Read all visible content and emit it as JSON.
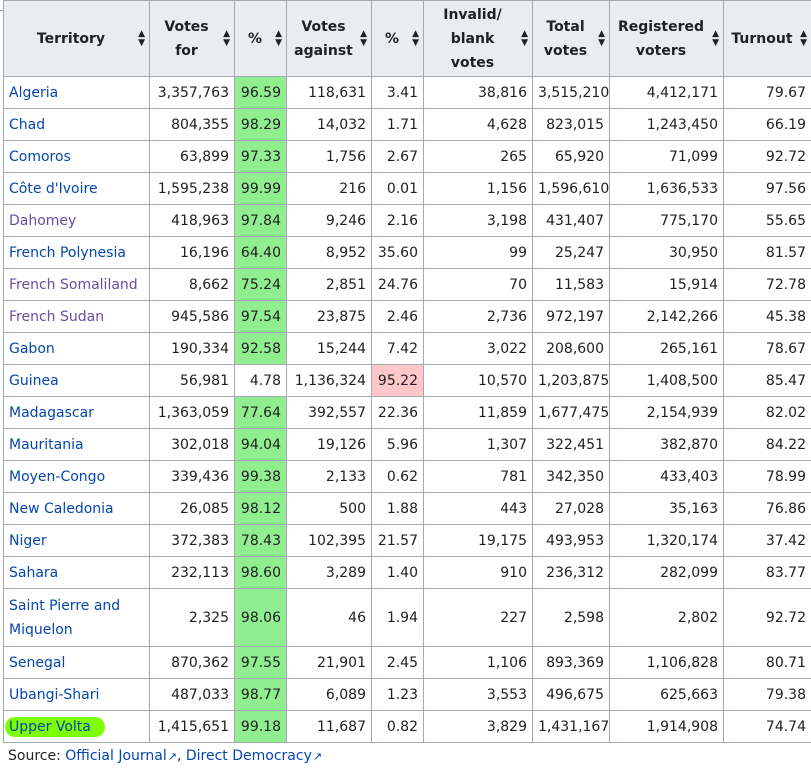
{
  "columns": [
    {
      "id": "territory",
      "label": "Territory"
    },
    {
      "id": "votes_for",
      "label": "Votes for"
    },
    {
      "id": "pct_for",
      "label": "%"
    },
    {
      "id": "votes_against",
      "label": "Votes against"
    },
    {
      "id": "pct_against",
      "label": "%"
    },
    {
      "id": "invalid",
      "label": "Invalid/ blank votes"
    },
    {
      "id": "total",
      "label": "Total votes"
    },
    {
      "id": "registered",
      "label": "Registered voters"
    },
    {
      "id": "turnout",
      "label": "Turnout"
    }
  ],
  "sort_icon": "sort-arrows-icon",
  "rows": [
    {
      "territory": "Algeria",
      "votes_for": "3,357,763",
      "pct_for": "96.59",
      "votes_against": "118,631",
      "pct_against": "3.41",
      "invalid": "38,816",
      "total": "3,515,210",
      "registered": "4,412,171",
      "turnout": "79.67"
    },
    {
      "territory": "Chad",
      "votes_for": "804,355",
      "pct_for": "98.29",
      "votes_against": "14,032",
      "pct_against": "1.71",
      "invalid": "4,628",
      "total": "823,015",
      "registered": "1,243,450",
      "turnout": "66.19"
    },
    {
      "territory": "Comoros",
      "votes_for": "63,899",
      "pct_for": "97.33",
      "votes_against": "1,756",
      "pct_against": "2.67",
      "invalid": "265",
      "total": "65,920",
      "registered": "71,099",
      "turnout": "92.72"
    },
    {
      "territory": "Côte d'Ivoire",
      "votes_for": "1,595,238",
      "pct_for": "99.99",
      "votes_against": "216",
      "pct_against": "0.01",
      "invalid": "1,156",
      "total": "1,596,610",
      "registered": "1,636,533",
      "turnout": "97.56"
    },
    {
      "territory": "Dahomey",
      "votes_for": "418,963",
      "pct_for": "97.84",
      "votes_against": "9,246",
      "pct_against": "2.16",
      "invalid": "3,198",
      "total": "431,407",
      "registered": "775,170",
      "turnout": "55.65"
    },
    {
      "territory": "French Polynesia",
      "votes_for": "16,196",
      "pct_for": "64.40",
      "votes_against": "8,952",
      "pct_against": "35.60",
      "invalid": "99",
      "total": "25,247",
      "registered": "30,950",
      "turnout": "81.57"
    },
    {
      "territory": "French Somaliland",
      "votes_for": "8,662",
      "pct_for": "75.24",
      "votes_against": "2,851",
      "pct_against": "24.76",
      "invalid": "70",
      "total": "11,583",
      "registered": "15,914",
      "turnout": "72.78"
    },
    {
      "territory": "French Sudan",
      "votes_for": "945,586",
      "pct_for": "97.54",
      "votes_against": "23,875",
      "pct_against": "2.46",
      "invalid": "2,736",
      "total": "972,197",
      "registered": "2,142,266",
      "turnout": "45.38"
    },
    {
      "territory": "Gabon",
      "votes_for": "190,334",
      "pct_for": "92.58",
      "votes_against": "15,244",
      "pct_against": "7.42",
      "invalid": "3,022",
      "total": "208,600",
      "registered": "265,161",
      "turnout": "78.67"
    },
    {
      "territory": "Guinea",
      "votes_for": "56,981",
      "pct_for": "4.78",
      "votes_against": "1,136,324",
      "pct_against": "95.22",
      "invalid": "10,570",
      "total": "1,203,875",
      "registered": "1,408,500",
      "turnout": "85.47"
    },
    {
      "territory": "Madagascar",
      "votes_for": "1,363,059",
      "pct_for": "77.64",
      "votes_against": "392,557",
      "pct_against": "22.36",
      "invalid": "11,859",
      "total": "1,677,475",
      "registered": "2,154,939",
      "turnout": "82.02"
    },
    {
      "territory": "Mauritania",
      "votes_for": "302,018",
      "pct_for": "94.04",
      "votes_against": "19,126",
      "pct_against": "5.96",
      "invalid": "1,307",
      "total": "322,451",
      "registered": "382,870",
      "turnout": "84.22"
    },
    {
      "territory": "Moyen-Congo",
      "votes_for": "339,436",
      "pct_for": "99.38",
      "votes_against": "2,133",
      "pct_against": "0.62",
      "invalid": "781",
      "total": "342,350",
      "registered": "433,403",
      "turnout": "78.99"
    },
    {
      "territory": "New Caledonia",
      "votes_for": "26,085",
      "pct_for": "98.12",
      "votes_against": "500",
      "pct_against": "1.88",
      "invalid": "443",
      "total": "27,028",
      "registered": "35,163",
      "turnout": "76.86"
    },
    {
      "territory": "Niger",
      "votes_for": "372,383",
      "pct_for": "78.43",
      "votes_against": "102,395",
      "pct_against": "21.57",
      "invalid": "19,175",
      "total": "493,953",
      "registered": "1,320,174",
      "turnout": "37.42"
    },
    {
      "territory": "Sahara",
      "votes_for": "232,113",
      "pct_for": "98.60",
      "votes_against": "3,289",
      "pct_against": "1.40",
      "invalid": "910",
      "total": "236,312",
      "registered": "282,099",
      "turnout": "83.77"
    },
    {
      "territory": "Saint Pierre and Miquelon",
      "votes_for": "2,325",
      "pct_for": "98.06",
      "votes_against": "46",
      "pct_against": "1.94",
      "invalid": "227",
      "total": "2,598",
      "registered": "2,802",
      "turnout": "92.72"
    },
    {
      "territory": "Senegal",
      "votes_for": "870,362",
      "pct_for": "97.55",
      "votes_against": "21,901",
      "pct_against": "2.45",
      "invalid": "1,106",
      "total": "893,369",
      "registered": "1,106,828",
      "turnout": "80.71"
    },
    {
      "territory": "Ubangi-Shari",
      "votes_for": "487,033",
      "pct_for": "98.77",
      "votes_against": "6,089",
      "pct_against": "1.23",
      "invalid": "3,553",
      "total": "496,675",
      "registered": "625,663",
      "turnout": "79.38"
    },
    {
      "territory": "Upper Volta",
      "votes_for": "1,415,651",
      "pct_for": "99.18",
      "votes_against": "11,687",
      "pct_against": "0.82",
      "invalid": "3,829",
      "total": "1,431,167",
      "registered": "1,914,908",
      "turnout": "74.74"
    }
  ],
  "source": {
    "label": "Source:",
    "links": [
      "Official Journal",
      "Direct Democracy"
    ],
    "separator": ","
  }
}
